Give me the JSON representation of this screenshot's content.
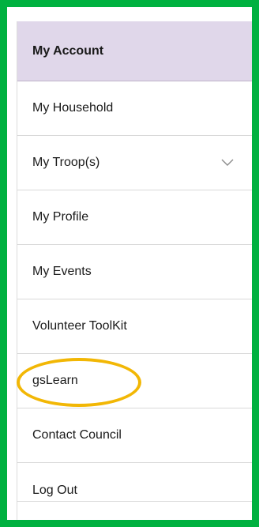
{
  "menu": {
    "items": [
      {
        "label": "My Account"
      },
      {
        "label": "My Household"
      },
      {
        "label": "My Troop(s)"
      },
      {
        "label": "My Profile"
      },
      {
        "label": "My Events"
      },
      {
        "label": "Volunteer ToolKit"
      },
      {
        "label": "gsLearn"
      },
      {
        "label": "Contact Council"
      },
      {
        "label": "Log Out"
      }
    ]
  },
  "colors": {
    "frame": "#00b140",
    "active_bg": "#e0d7ea",
    "highlight": "#f2b705"
  },
  "icons": {
    "troops_toggle": "chevron-down-icon"
  }
}
